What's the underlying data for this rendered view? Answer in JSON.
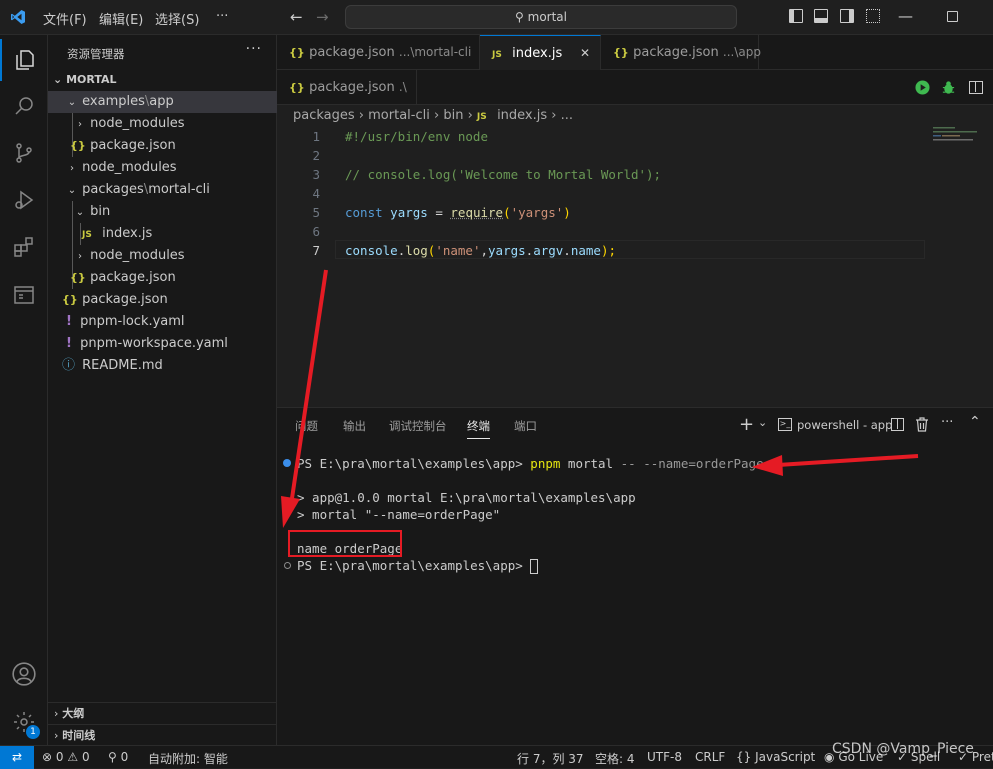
{
  "titlebar": {
    "menus": [
      "文件(F)",
      "编辑(E)",
      "选择(S)",
      "···"
    ],
    "search": "mortal"
  },
  "sidebar": {
    "title": "资源管理器",
    "more": "···",
    "root": "MORTAL",
    "items": [
      {
        "label": "examples",
        "sep": "\\",
        "label2": "app",
        "kind": "folder-open"
      },
      {
        "label": "node_modules",
        "kind": "folder"
      },
      {
        "label": "package.json",
        "kind": "json"
      },
      {
        "label": "node_modules",
        "kind": "folder"
      },
      {
        "label": "packages",
        "sep": "\\",
        "label2": "mortal-cli",
        "kind": "folder-open"
      },
      {
        "label": "bin",
        "kind": "folder-open"
      },
      {
        "label": "index.js",
        "kind": "js"
      },
      {
        "label": "node_modules",
        "kind": "folder"
      },
      {
        "label": "package.json",
        "kind": "json"
      },
      {
        "label": "package.json",
        "kind": "json"
      },
      {
        "label": "pnpm-lock.yaml",
        "kind": "yaml"
      },
      {
        "label": "pnpm-workspace.yaml",
        "kind": "yaml"
      },
      {
        "label": "README.md",
        "kind": "info"
      }
    ],
    "outline": "大纲",
    "timeline": "时间线",
    "accounts_badge": "1"
  },
  "tabs": [
    {
      "label": "package.json",
      "desc": "...\\mortal-cli",
      "icon": "{}"
    },
    {
      "label": "index.js",
      "desc": "",
      "icon": "JS",
      "close": "✕"
    },
    {
      "label": "package.json",
      "desc": "...\\app",
      "icon": "{}"
    }
  ],
  "tab_row2": {
    "label": "package.json",
    "desc": ".\\",
    "icon": "{}"
  },
  "breadcrumbs": {
    "p1": "packages",
    "p2": "mortal-cli",
    "p3": "bin",
    "p4": "index.js",
    "p5": "...",
    "icon": "JS"
  },
  "code": {
    "line_numbers": [
      "1",
      "2",
      "3",
      "4",
      "5",
      "6",
      "7"
    ],
    "l1": "#!/usr/bin/env node",
    "l3": "// console.log('Welcome to Mortal World');",
    "l5_kw": "const",
    "l5_var": "yargs",
    "l5_eq": " = ",
    "l5_fn": "require",
    "l5_p1": "(",
    "l5_str": "'yargs'",
    "l5_p2": ")",
    "l7_obj": "console",
    "l7_dot": ".",
    "l7_fn": "log",
    "l7_p1": "(",
    "l7_str": "'name'",
    "l7_rest1": ",",
    "l7_obj2": "yargs",
    "l7_dot2": ".",
    "l7_prop1": "argv",
    "l7_dot3": ".",
    "l7_prop2": "name",
    "l7_end": ");"
  },
  "panel": {
    "tabs": [
      "问题",
      "输出",
      "调试控制台",
      "终端",
      "端口"
    ],
    "active": "终端",
    "shell": "powershell - app"
  },
  "terminal": {
    "l1_prompt": "PS E:\\pra\\mortal\\examples\\app> ",
    "l1_cmd": "pnpm",
    "l1_arg": " mortal ",
    "l1_flag": "-- --name=orderPage",
    "l2": "> app@1.0.0 mortal E:\\pra\\mortal\\examples\\app",
    "l3": "> mortal \"--name=orderPage\"",
    "l4": "name orderPage",
    "l5_prompt": "PS E:\\pra\\mortal\\examples\\app> "
  },
  "statusbar": {
    "errors": "0",
    "warnings": "0",
    "ports": "0",
    "auto_attach": "自动附加: 智能",
    "position": "行 7，列 37",
    "spaces": "空格: 4",
    "encoding": "UTF-8",
    "eol": "CRLF",
    "language": "JavaScript",
    "golive": "Go Live",
    "spell": "Spell",
    "prettier": "Prett"
  },
  "watermark": "CSDN @Vamp_Piece",
  "colors": {
    "accent": "#0078d4",
    "arrow": "#e51b24"
  }
}
